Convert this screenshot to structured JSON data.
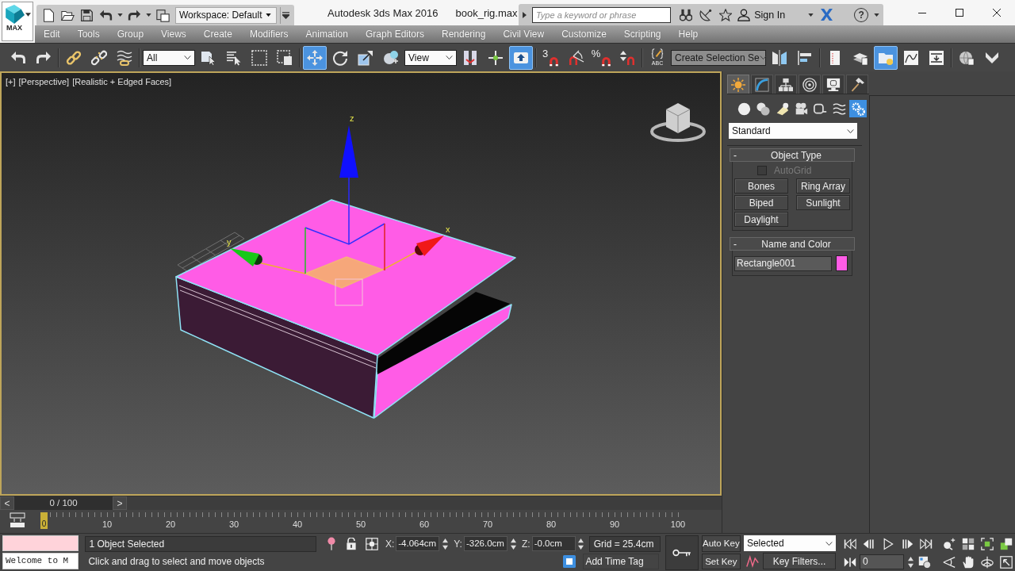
{
  "title_bar": {
    "app_button": "MAX",
    "workspace": "Workspace: Default",
    "title": "Autodesk 3ds Max 2016",
    "file_name": "book_rig.max",
    "search": {
      "placeholder": "Type a keyword or phrase"
    },
    "sign_in": "Sign In",
    "help": "?"
  },
  "menu_bar": [
    "Edit",
    "Tools",
    "Group",
    "Views",
    "Create",
    "Modifiers",
    "Animation",
    "Graph Editors",
    "Rendering",
    "Civil View",
    "Customize",
    "Scripting",
    "Help"
  ],
  "main_toolbar": [
    {
      "items": [
        {
          "kind": "tool",
          "selected": false
        },
        {
          "kind": "tool",
          "selected": false
        }
      ]
    },
    {
      "items": [
        {
          "kind": "tool",
          "selected": false
        },
        {
          "kind": "tool",
          "selected": false
        },
        {
          "kind": "tool",
          "selected": false
        }
      ]
    },
    {
      "items": [
        {
          "kind": "dropdown",
          "value": "All"
        },
        {
          "kind": "tool",
          "selected": false
        },
        {
          "kind": "tool",
          "selected": false
        },
        {
          "kind": "tool",
          "selected": false
        },
        {
          "kind": "tool",
          "selected": false
        }
      ]
    },
    {
      "items": [
        {
          "kind": "tool",
          "selected": true
        },
        {
          "kind": "tool",
          "selected": false
        },
        {
          "kind": "tool",
          "selected": false
        },
        {
          "kind": "tool",
          "selected": false
        },
        {
          "kind": "dropdown",
          "value": "View"
        },
        {
          "kind": "tool",
          "selected": false
        },
        {
          "kind": "tool",
          "selected": false
        },
        {
          "kind": "tool",
          "selected": true
        }
      ]
    },
    {
      "items": [
        {
          "kind": "tool",
          "selected": false,
          "label": "3"
        },
        {
          "kind": "tool",
          "selected": false
        },
        {
          "kind": "tool",
          "selected": false,
          "label": "%"
        },
        {
          "kind": "tool",
          "selected": false
        }
      ]
    },
    {
      "items": [
        {
          "kind": "tool",
          "selected": false,
          "label": "ABC"
        },
        {
          "kind": "combo",
          "value": "Create Selection Se"
        },
        {
          "kind": "tool",
          "selected": false
        },
        {
          "kind": "tool",
          "selected": false
        }
      ]
    },
    {
      "items": [
        {
          "kind": "tool",
          "selected": false
        },
        {
          "kind": "tool",
          "selected": false
        },
        {
          "kind": "tool",
          "selected": true
        },
        {
          "kind": "tool",
          "selected": false
        },
        {
          "kind": "tool",
          "selected": false
        }
      ]
    },
    {
      "items": [
        {
          "kind": "tool",
          "selected": false
        },
        {
          "kind": "tool",
          "selected": false
        }
      ]
    }
  ],
  "viewport": {
    "labels": [
      "[+]",
      "[Perspective]",
      "[Realistic + Edged Faces]"
    ],
    "axis_labels": [
      "z",
      "y",
      "x"
    ]
  },
  "command_panel": {
    "tabs": [
      {
        "selected": true
      },
      {
        "selected": false
      },
      {
        "selected": false
      },
      {
        "selected": false
      },
      {
        "selected": false
      },
      {
        "selected": false
      }
    ],
    "categories": [
      {
        "selected": false
      },
      {
        "selected": false
      },
      {
        "selected": false
      },
      {
        "selected": false
      },
      {
        "selected": false
      },
      {
        "selected": false
      },
      {
        "selected": true
      }
    ],
    "type_dropdown": "Standard",
    "object_type": {
      "toggle": "-",
      "title": "Object Type",
      "autogrid": {
        "label": "AutoGrid",
        "checked": false,
        "disabled": true
      },
      "buttons": [
        "Bones",
        "Ring Array",
        "Biped",
        "Sunlight",
        "Daylight"
      ]
    },
    "name_and_color": {
      "toggle": "-",
      "title": "Name and Color",
      "name": "Rectangle001",
      "color": "#ff5ce6"
    }
  },
  "time_slider": {
    "prev": "<",
    "position": "0 / 100",
    "next": ">",
    "level": 0
  },
  "track_bar": {
    "current": "0",
    "labels": [
      "10",
      "20",
      "30",
      "40",
      "50",
      "60",
      "70",
      "80",
      "90",
      "100"
    ]
  },
  "status_bar": {
    "listener_output": "Welcome to M",
    "selection": "1 Object Selected",
    "prompt": "Click and drag to select and move objects",
    "coordinates": [
      {
        "axis": "X:",
        "value": "-4.064cm"
      },
      {
        "axis": "Y:",
        "value": "-326.0cm"
      },
      {
        "axis": "Z:",
        "value": "-0.0cm"
      }
    ],
    "grid": "Grid = 25.4cm",
    "time_tag": "Add Time Tag",
    "auto_key": {
      "label": "Auto Key",
      "on": false
    },
    "key_mode": "Selected",
    "set_key": "Set Key",
    "key_filters": "Key Filters...",
    "frame": "0"
  }
}
